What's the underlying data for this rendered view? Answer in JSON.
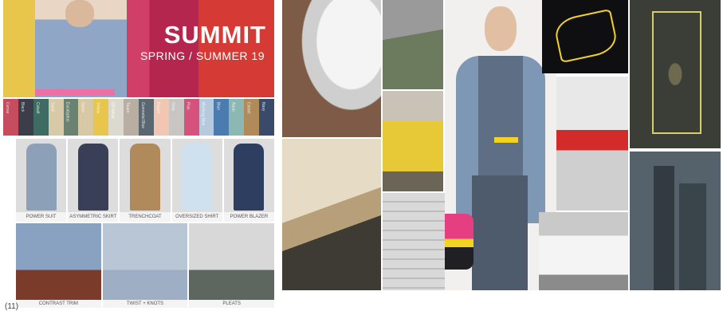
{
  "hero": {
    "title": "SUMMIT",
    "subtitle": "SPRING / SUMMER 19"
  },
  "palette": [
    {
      "color": "#c54d5e",
      "label": "Cerise"
    },
    {
      "color": "#3b3e4a",
      "label": "Black"
    },
    {
      "color": "#3e6c62",
      "label": "Cobalt"
    },
    {
      "color": "#d8c9a8",
      "label": "Sand"
    },
    {
      "color": "#6a8370",
      "label": "Eucalyptus"
    },
    {
      "color": "#d7c9a6",
      "label": "Stone"
    },
    {
      "color": "#e7c64b",
      "label": "Yellow"
    },
    {
      "color": "#dcdad0",
      "label": "Off White"
    },
    {
      "color": "#b8aea1",
      "label": "Taupe"
    },
    {
      "color": "#5b6770",
      "label": "Gunmetal Blue"
    },
    {
      "color": "#f1c6b3",
      "label": "Peach"
    },
    {
      "color": "#c8c6c5",
      "label": "Grey"
    },
    {
      "color": "#d4527b",
      "label": "Pink"
    },
    {
      "color": "#b7c9dd",
      "label": "Morning Blue"
    },
    {
      "color": "#4b7cb0",
      "label": "Blue"
    },
    {
      "color": "#8cb7b3",
      "label": "Aqua"
    },
    {
      "color": "#b18a5a",
      "label": "Camel"
    },
    {
      "color": "#3a4a6a",
      "label": "Navy"
    }
  ],
  "looks": [
    {
      "caption": "POWER SUIT",
      "color": "#8ca1b7"
    },
    {
      "caption": "ASYMMETRIC SKIRT",
      "color": "#3a3f58"
    },
    {
      "caption": "TRENCHCOAT",
      "color": "#b08a5b"
    },
    {
      "caption": "OVERSIZED SHIRT",
      "color": "#cfe0ef"
    },
    {
      "caption": "POWER BLAZER",
      "color": "#2e3e60"
    }
  ],
  "tiles": [
    {
      "caption": "CONTRAST TRIM",
      "top": "#8aa2c2",
      "bottom": "#7a3b2b"
    },
    {
      "caption": "TWIST + KNOTS",
      "top": "#b9c6d6",
      "bottom": "#9eaec4"
    },
    {
      "caption": "PLEATS",
      "top": "#d8d8d8",
      "bottom": "#5e6660"
    }
  ],
  "footnote": "(11)",
  "footnote_right": ""
}
